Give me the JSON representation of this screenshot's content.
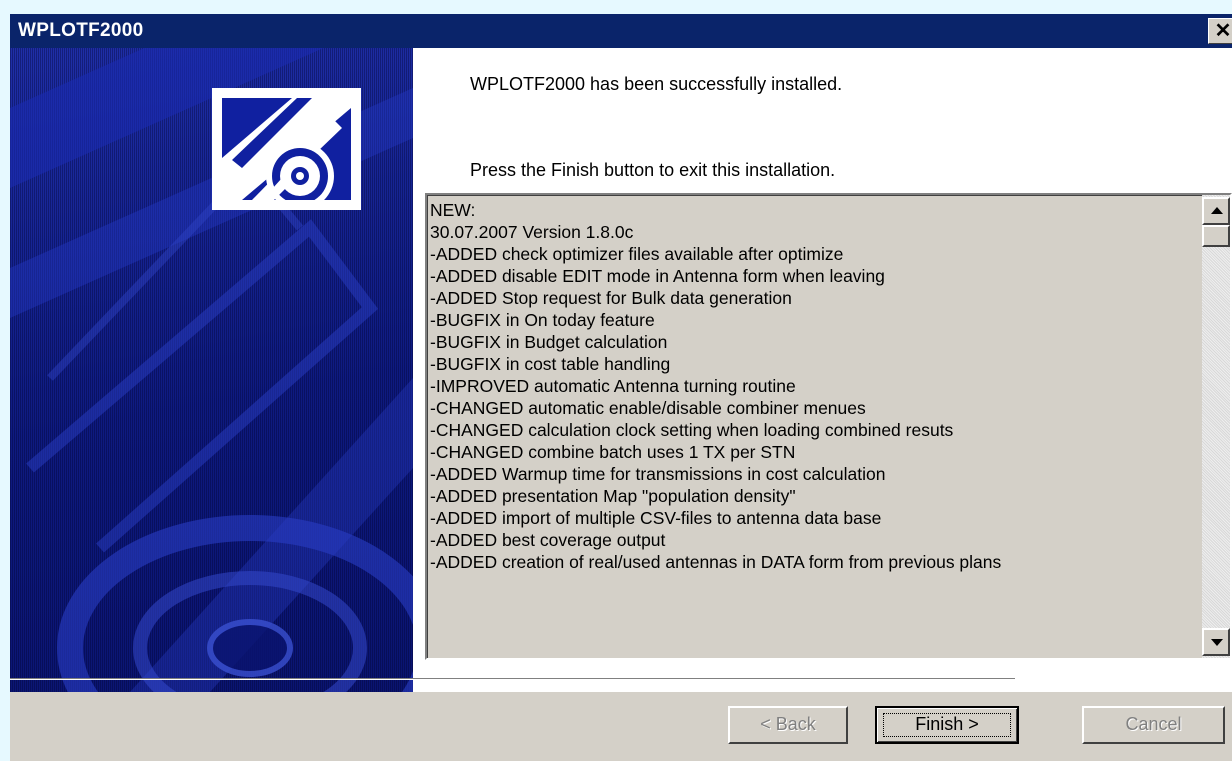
{
  "window": {
    "title": "WPLOTF2000",
    "close_glyph": "✕"
  },
  "content": {
    "message_installed": "WPLOTF2000 has been successfully installed.",
    "message_finish": "Press the Finish button to exit this installation.",
    "release_notes": [
      "NEW:",
      "30.07.2007 Version 1.8.0c",
      "-ADDED check optimizer files available after optimize",
      "-ADDED disable EDIT mode in Antenna form when leaving",
      "-ADDED Stop request for Bulk data generation",
      "-BUGFIX in On today feature",
      "-BUGFIX in Budget calculation",
      "-BUGFIX in cost table handling",
      "-IMPROVED automatic Antenna turning routine",
      "-CHANGED automatic enable/disable combiner menues",
      "-CHANGED calculation clock setting when loading combined resuts",
      "-CHANGED combine batch uses 1 TX per STN",
      "-ADDED Warmup time for transmissions in cost calculation",
      "-ADDED presentation Map \"population density\"",
      "-ADDED import of multiple CSV-files to antenna data base",
      "-ADDED best coverage output",
      "-ADDED creation of real/used antennas in DATA form from previous plans"
    ]
  },
  "buttons": {
    "back_label": "< Back",
    "finish_label": "Finish >",
    "cancel_label": "Cancel"
  },
  "icons": {
    "close": "close-icon",
    "scroll_up": "scroll-up-arrow-icon",
    "scroll_down": "scroll-down-arrow-icon",
    "installer_logo": "installer-cd-logo-icon"
  },
  "colors": {
    "titlebar": "#0a246a",
    "side_panel": "#0e1a80",
    "dialog_face": "#d4d0c8",
    "desktop": "#e6f9ff"
  }
}
